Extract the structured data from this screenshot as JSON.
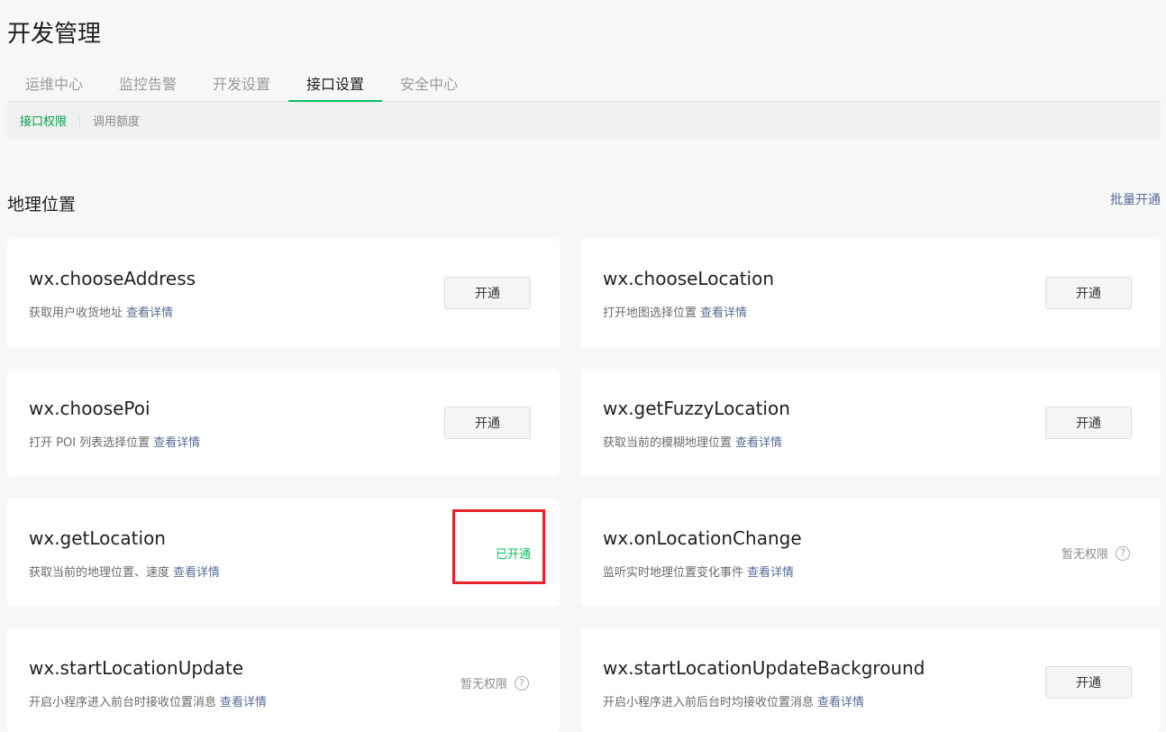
{
  "page": {
    "title": "开发管理"
  },
  "main_tabs": [
    {
      "label": "运维中心"
    },
    {
      "label": "监控告警"
    },
    {
      "label": "开发设置"
    },
    {
      "label": "接口设置"
    },
    {
      "label": "安全中心"
    }
  ],
  "active_main_tab": "接口设置",
  "sub_tabs": [
    {
      "label": "接口权限"
    },
    {
      "label": "调用额度"
    }
  ],
  "section": {
    "title": "地理位置",
    "batch_action": "批量开通"
  },
  "detail_link_label": "查看详情",
  "apis": [
    {
      "name": "wx.chooseAddress",
      "desc": "获取用户收货地址",
      "status": "open_button",
      "status_text": "开通"
    },
    {
      "name": "wx.chooseLocation",
      "desc": "打开地图选择位置",
      "status": "open_button",
      "status_text": "开通"
    },
    {
      "name": "wx.choosePoi",
      "desc": "打开 POI 列表选择位置",
      "status": "open_button",
      "status_text": "开通"
    },
    {
      "name": "wx.getFuzzyLocation",
      "desc": "获取当前的模糊地理位置",
      "status": "open_button",
      "status_text": "开通"
    },
    {
      "name": "wx.getLocation",
      "desc": "获取当前的地理位置、速度",
      "status": "opened",
      "status_text": "已开通"
    },
    {
      "name": "wx.onLocationChange",
      "desc": "监听实时地理位置变化事件",
      "status": "no_permission",
      "status_text": "暂无权限"
    },
    {
      "name": "wx.startLocationUpdate",
      "desc": "开启小程序进入前台时接收位置消息",
      "status": "no_permission",
      "status_text": "暂无权限"
    },
    {
      "name": "wx.startLocationUpdateBackground",
      "desc": "开启小程序进入前后台时均接收位置消息",
      "status": "open_button",
      "status_text": "开通"
    }
  ],
  "colors": {
    "accent": "#07c160",
    "link": "#576b95",
    "highlight": "#e8222b"
  },
  "icons": {
    "help": "question-circle-icon"
  }
}
